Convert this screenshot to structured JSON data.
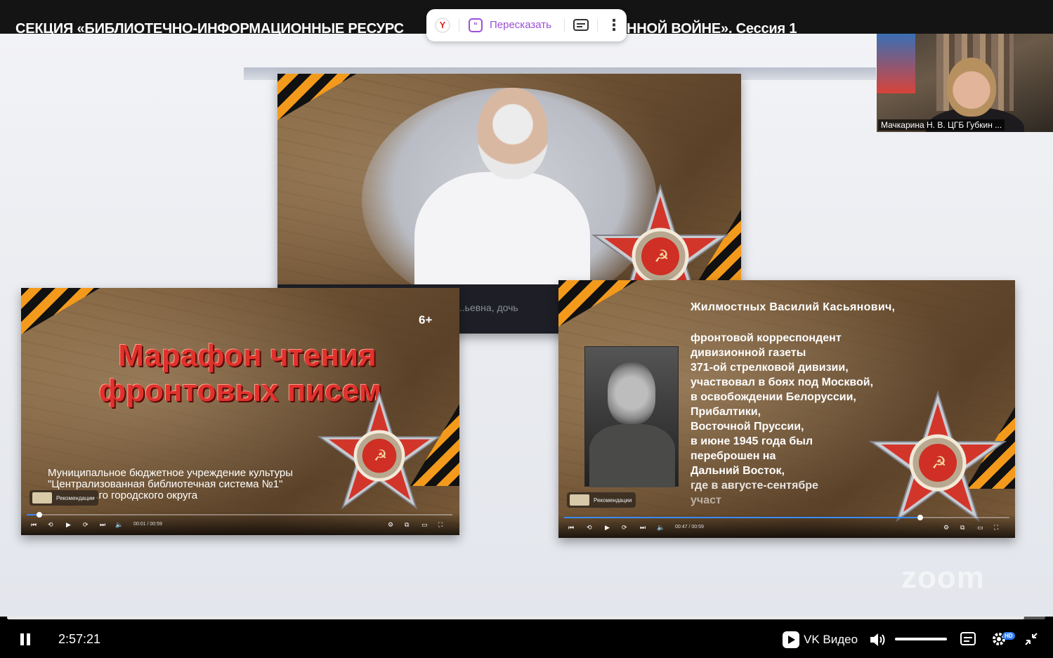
{
  "header": {
    "title_left": "СЕКЦИЯ «БИБЛИОТЕЧНО-ИНФОРМАЦИОННЫЕ РЕСУРС",
    "title_right": "ННОЙ ВОЙНЕ». Сессия 1"
  },
  "yandex_popup": {
    "logo_icon": "yandex-logo-icon",
    "retell_label": "Пересказать",
    "retell_icon": "quote-bubble-icon",
    "subtitles_icon": "subtitles-icon",
    "more_icon": "more-vertical-icon"
  },
  "webcam": {
    "name_tag": "Мачкарина Н. В. ЦГБ Губкин ..."
  },
  "card_left": {
    "age_rating": "6+",
    "title_line1": "Марафон чтения",
    "title_line2": "фронтовых писем",
    "org_line1": "Муниципальное бюджетное учреждение культуры",
    "org_line2": "\"Централизованная библиотечная система №1\"",
    "org_line3": "...го городского округа",
    "recommendations_label": "Рекомендации",
    "time": "00:01 / 00:59",
    "progress_fraction": 0.03
  },
  "card_center": {
    "bottom_text": "...ьевна, дочь"
  },
  "card_right": {
    "hero_name": "Жилмостных Василий Касьянович,",
    "bio_lines": [
      "фронтовой корреспондент",
      "дивизионной газеты",
      "371-ой стрелковой дивизии,",
      "участвовал в боях под Москвой,",
      "в освобождении Белоруссии,",
      "Прибалтики,",
      "Восточной Пруссии,",
      "в июне 1945 года был",
      "переброшен на",
      "Дальний Восток,",
      "где в августе-сентябре",
      "участ"
    ],
    "recommendations_label": "Рекомендации",
    "time": "00:47 / 00:59",
    "progress_fraction": 0.8
  },
  "watermark": "zoom",
  "player": {
    "current_time": "2:57:21",
    "progress_fraction": 0.98,
    "brand": "VK Видео",
    "volume_fraction": 1.0,
    "hd_badge": "HD",
    "colors": {
      "accent": "#2f7cf5",
      "track": "#e9e9e9"
    }
  }
}
